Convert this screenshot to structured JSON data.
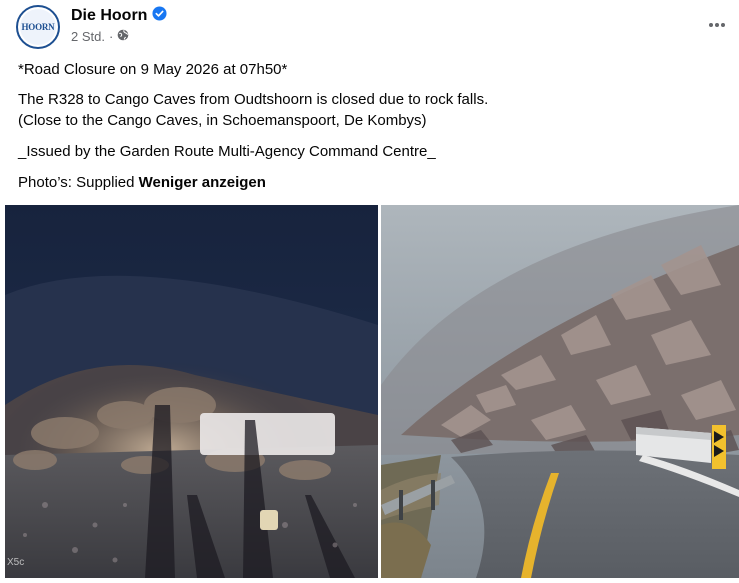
{
  "page": {
    "name": "Die Hoorn",
    "avatar_text": "HOORN",
    "timestamp": "2 Std.",
    "separator": "·"
  },
  "post": {
    "line1": "*Road Closure on 9 May 2026 at 07h50*",
    "line2": "The R328 to Cango Caves from Oudtshoorn is closed due to rock falls.",
    "line3": "(Close to the Cango Caves, in Schoemanspoort, De Kombys)",
    "line4": "_Issued by the Garden Route Multi-Agency Command Centre_",
    "line5_prefix": "Photo’s: Supplied",
    "see_less": "Weniger anzeigen"
  },
  "photos": {
    "left_watermark": "X5c"
  },
  "icons": {
    "verified": "verified-badge-icon",
    "globe": "globe-icon",
    "more": "more-horizontal-icon"
  },
  "colors": {
    "verified_blue": "#1877f2",
    "secondary_text": "#65676b",
    "brand_blue": "#1d4f91"
  }
}
